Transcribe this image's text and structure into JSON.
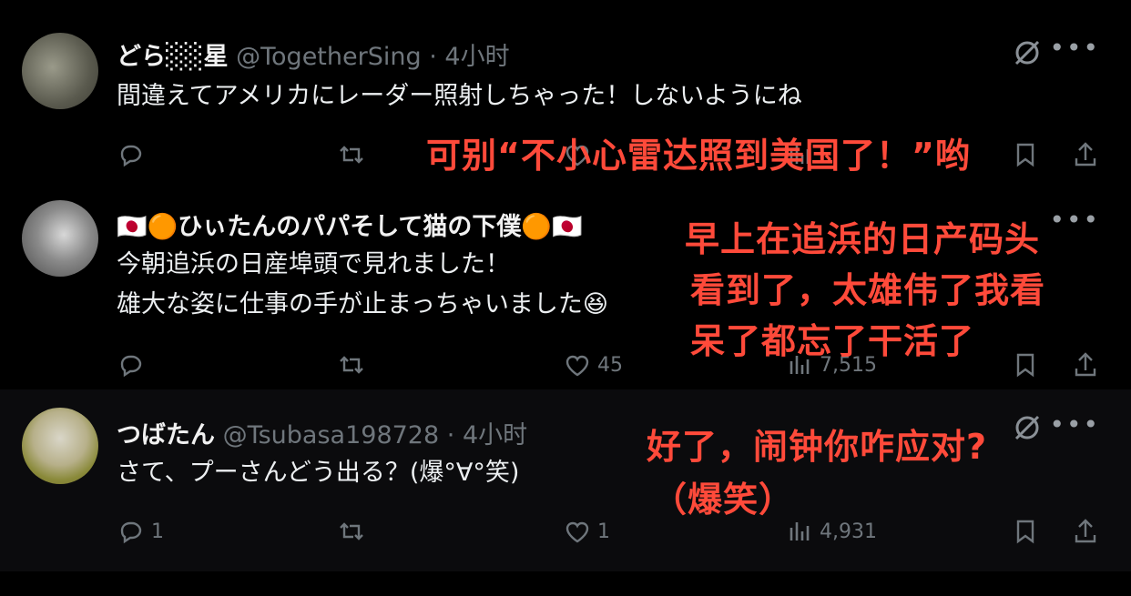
{
  "tweets": [
    {
      "name": "どら░░星",
      "handle": "@TogetherSing",
      "dot": "·",
      "time": "4小时",
      "body": [
        "間違えてアメリカにレーダー照射しちゃった！しないようにね"
      ],
      "replies": "",
      "likes": "",
      "views": ""
    },
    {
      "name": "🇯🇵🟠ひぃたんのパパそして猫の下僕🟠🇯🇵",
      "handle": "",
      "dot": "",
      "time": "",
      "body": [
        "今朝追浜の日産埠頭で見れました！",
        "雄大な姿に仕事の手が止まっちゃいました😆"
      ],
      "replies": "",
      "likes": "45",
      "views": "7,515"
    },
    {
      "name": "つばたん",
      "handle": "@Tsubasa198728",
      "dot": "·",
      "time": "4小时",
      "body": [
        "さて、プーさんどう出る？(爆°∀°笑)"
      ],
      "replies": "1",
      "likes": "1",
      "views": "4,931"
    }
  ],
  "overlays": {
    "o1": "可别“不小心雷达照到美国了！”哟",
    "o2a": "早上在追浜的日产码头",
    "o2b": "看到了，太雄伟了我看",
    "o2c": "呆了都忘了干活了",
    "o3a": "好了，闹钟你咋应对?",
    "o3b": "（爆笑）"
  },
  "colors": {
    "overlay": "#ff4a3a",
    "muted": "#6f767c",
    "background": "#000000"
  }
}
